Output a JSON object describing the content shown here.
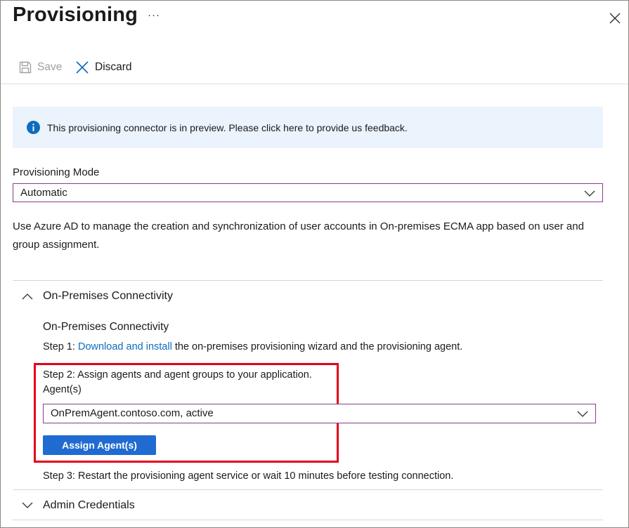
{
  "header": {
    "title": "Provisioning",
    "more_label": "···"
  },
  "toolbar": {
    "save_label": "Save",
    "discard_label": "Discard"
  },
  "banner": {
    "text": "This provisioning connector is in preview. Please click here to provide us feedback."
  },
  "mode": {
    "label": "Provisioning Mode",
    "value": "Automatic"
  },
  "description": "Use Azure AD to manage the creation and synchronization of user accounts in On-premises ECMA app based on user and group assignment.",
  "sections": {
    "connectivity": {
      "header": "On-Premises Connectivity",
      "title": "On-Premises Connectivity",
      "step1_prefix": "Step 1: ",
      "step1_link": "Download and install",
      "step1_suffix": " the on-premises provisioning wizard and the provisioning agent.",
      "step2": "Step 2: Assign agents and agent groups to your application.",
      "agents_label": "Agent(s)",
      "agents_value": "OnPremAgent.contoso.com, active",
      "assign_button": "Assign Agent(s)",
      "step3": "Step 3: Restart the provisioning agent service or wait 10 minutes before testing connection."
    },
    "admin": {
      "header": "Admin Credentials"
    }
  },
  "colors": {
    "accent": "#1f6bd1",
    "link": "#0f6cbd",
    "highlight": "#e3001b",
    "banner_bg": "#ebf3fc",
    "select_border": "#8a3b8f"
  },
  "icons": {
    "close": "close-icon",
    "save": "save-icon",
    "discard": "discard-icon",
    "info": "info-icon",
    "chevron_down": "chevron-down-icon",
    "chevron_up": "chevron-up-icon"
  }
}
